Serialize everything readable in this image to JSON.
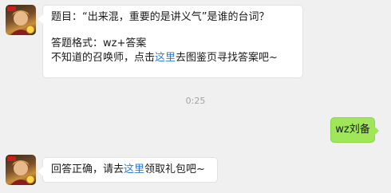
{
  "messages": {
    "question": {
      "line1": "题目：“出来混，重要的是讲义气”是谁的台词？",
      "line2": "答题格式：wz+答案",
      "line3_prefix": "不知道的召唤师，点击",
      "line3_link": "这里",
      "line3_suffix": "去图鉴页寻找答案吧~"
    },
    "timestamp": "0:25",
    "user_reply": "wz刘备",
    "answer": {
      "prefix": "回答正确，请去",
      "link": "这里",
      "suffix": "领取礼包吧~"
    }
  },
  "colors": {
    "background": "#f0f0f0",
    "user_bubble": "#9fe659",
    "link": "#2f7bd0"
  },
  "icons": {
    "avatar": "game-hero-avatar-icon"
  }
}
